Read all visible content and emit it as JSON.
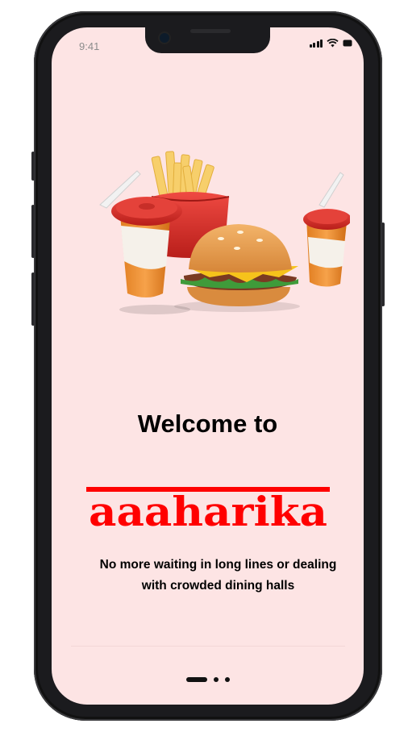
{
  "status_bar": {
    "time": "9:41"
  },
  "welcome": {
    "heading": "Welcome to"
  },
  "brand": {
    "name": "aaaharika",
    "color": "#ff0000"
  },
  "subtitle": {
    "line1": "No more waiting in long lines or dealing",
    "line2": "with crowded dining halls"
  },
  "pagination": {
    "total": 3,
    "current": 1
  }
}
